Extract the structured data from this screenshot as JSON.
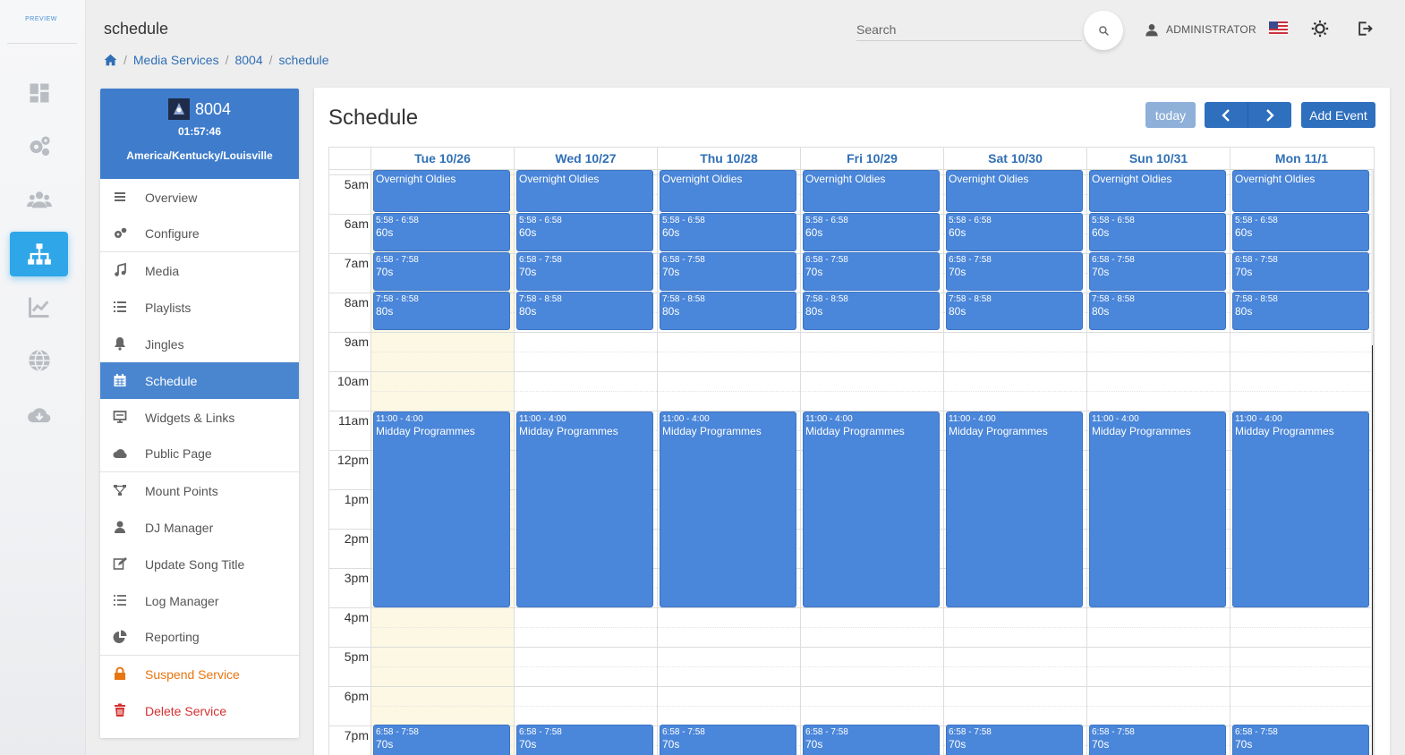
{
  "rail": {
    "logo_text": "PREVIEW",
    "items": [
      "dashboard-icon",
      "gears-icon",
      "users-icon",
      "sitemap-icon",
      "chart-icon",
      "globe-icon",
      "cloud-download-icon"
    ]
  },
  "header": {
    "title": "schedule",
    "search_placeholder": "Search",
    "user_name": "ADMINISTRATOR"
  },
  "breadcrumb": [
    "Media Services",
    "8004",
    "schedule"
  ],
  "service": {
    "name": "8004",
    "time": "01:57:46",
    "timezone": "America/Kentucky/Louisville"
  },
  "menu": [
    {
      "label": "Overview",
      "icon": "list-icon"
    },
    {
      "label": "Configure",
      "icon": "gears-icon"
    },
    {
      "label": "Media",
      "icon": "music-icon"
    },
    {
      "label": "Playlists",
      "icon": "playlist-icon"
    },
    {
      "label": "Jingles",
      "icon": "bell-icon"
    },
    {
      "label": "Schedule",
      "icon": "calendar-icon",
      "active": true
    },
    {
      "label": "Widgets & Links",
      "icon": "widget-icon"
    },
    {
      "label": "Public Page",
      "icon": "cloud-icon"
    },
    {
      "label": "Mount Points",
      "icon": "mount-icon"
    },
    {
      "label": "DJ Manager",
      "icon": "user-icon"
    },
    {
      "label": "Update Song Title",
      "icon": "edit-icon"
    },
    {
      "label": "Log Manager",
      "icon": "log-icon"
    },
    {
      "label": "Reporting",
      "icon": "pie-icon"
    },
    {
      "label": "Suspend Service",
      "icon": "lock-icon"
    },
    {
      "label": "Delete Service",
      "icon": "trash-icon"
    }
  ],
  "schedule": {
    "title": "Schedule",
    "today_label": "today",
    "add_label": "Add Event",
    "days": [
      "Tue 10/26",
      "Wed 10/27",
      "Thu 10/28",
      "Fri 10/29",
      "Sat 10/30",
      "Sun 10/31",
      "Mon 11/1"
    ],
    "hours": [
      "5am",
      "6am",
      "7am",
      "8am",
      "9am",
      "10am",
      "11am",
      "12pm",
      "1pm",
      "2pm",
      "3pm",
      "4pm",
      "5pm",
      "6pm",
      "7pm"
    ],
    "events": [
      {
        "time": "",
        "title": "Overnight Oldies"
      },
      {
        "time": "5:58 - 6:58",
        "title": "60s"
      },
      {
        "time": "6:58 - 7:58",
        "title": "70s"
      },
      {
        "time": "7:58 - 8:58",
        "title": "80s"
      },
      {
        "time": "11:00 - 4:00",
        "title": "Midday Programmes"
      },
      {
        "time": "6:58 - 7:58",
        "title": "70s"
      }
    ]
  },
  "colors": {
    "primary": "#2e6fbe",
    "event": "#4a86d9",
    "today_bg": "#fcf8e3",
    "rail_active": "#2ea6e8",
    "warn": "#e8750f",
    "danger": "#d63030"
  }
}
